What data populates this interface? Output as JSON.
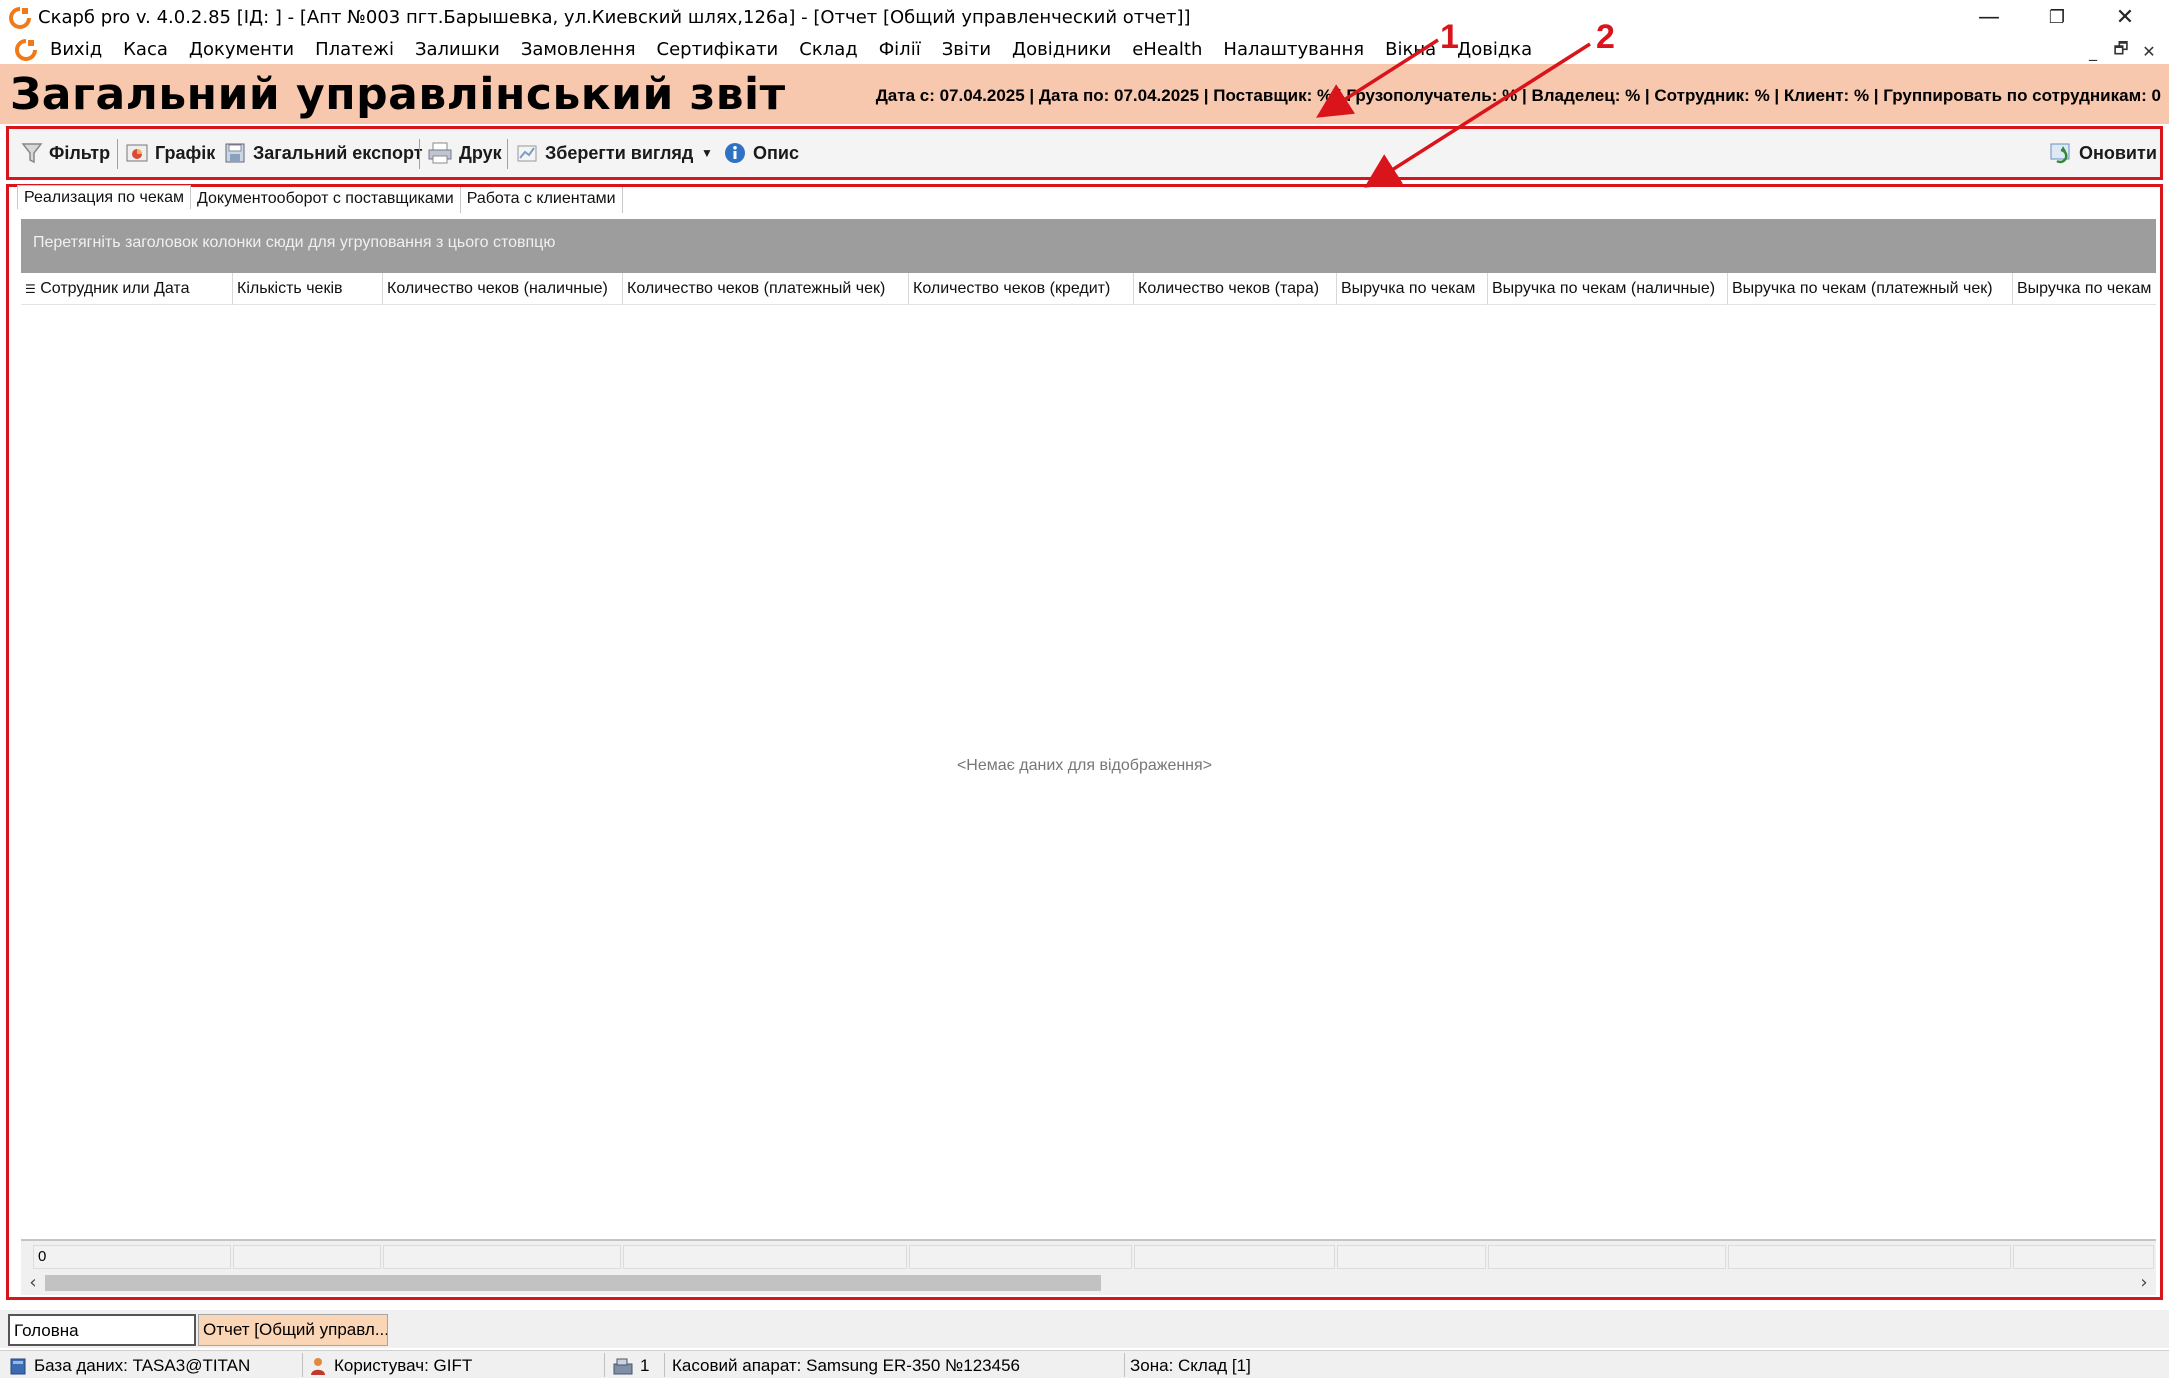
{
  "window": {
    "title": "Скарб pro v. 4.0.2.85 [ІД:       ] - [Апт №003 пгт.Барышевка, ул.Киевский шлях,126а] - [Отчет [Общий управленческий отчет]]"
  },
  "menu": {
    "items": [
      "Вихід",
      "Каса",
      "Документи",
      "Платежі",
      "Залишки",
      "Замовлення",
      "Сертифікати",
      "Склад",
      "Філії",
      "Звіти",
      "Довідники",
      "eHealth",
      "Налаштування",
      "Вікна",
      "Довідка"
    ]
  },
  "report": {
    "title": "Загальний управлінський звіт",
    "params": "Дата с: 07.04.2025 | Дата по: 07.04.2025 | Поставщик: % | Грузополучатель: % | Владелец: % | Сотрудник: % | Клиент: % | Группировать по сотрудникам: 0"
  },
  "toolbar": {
    "filter": "Фільтр",
    "chart": "Графік",
    "export": "Загальний експорт",
    "print": "Друк",
    "save_view": "Зберегти вигляд",
    "info": "Опис",
    "refresh": "Оновити"
  },
  "tabs": [
    "Реализация по чекам",
    "Документооборот с поставщиками",
    "Работа с клиентами"
  ],
  "grid": {
    "group_hint": "Перетягніть заголовок колонки сюди для угруповання з цього стовпцю",
    "columns": [
      "Сотрудник или Дата",
      "Кількість чеків",
      "Количество чеков (наличные)",
      "Количество чеков (платежный чек)",
      "Количество чеков (кредит)",
      "Количество чеков (тара)",
      "Выручка по чекам",
      "Выручка по чекам (наличные)",
      "Выручка по чекам (платежный чек)",
      "Выручка по чекам"
    ],
    "empty": "<Немає даних для відображення>",
    "footer_count": "0"
  },
  "mdi_tabs": [
    "Головна",
    "Отчет [Общий управл..."
  ],
  "status": {
    "db": "База даних: TASA3@TITAN",
    "user": "Користувач: GIFT",
    "register_count": "1",
    "register": "Касовий апарат: Samsung ER-350 №123456",
    "zone": "Зона: Склад [1]"
  },
  "annotations": {
    "one": "1",
    "two": "2"
  },
  "colors": {
    "header_bg": "#f7c8ae",
    "annotation_red": "#d9141b",
    "group_panel": "#9d9d9d",
    "active_mdi_tab": "#fbd6b6"
  }
}
